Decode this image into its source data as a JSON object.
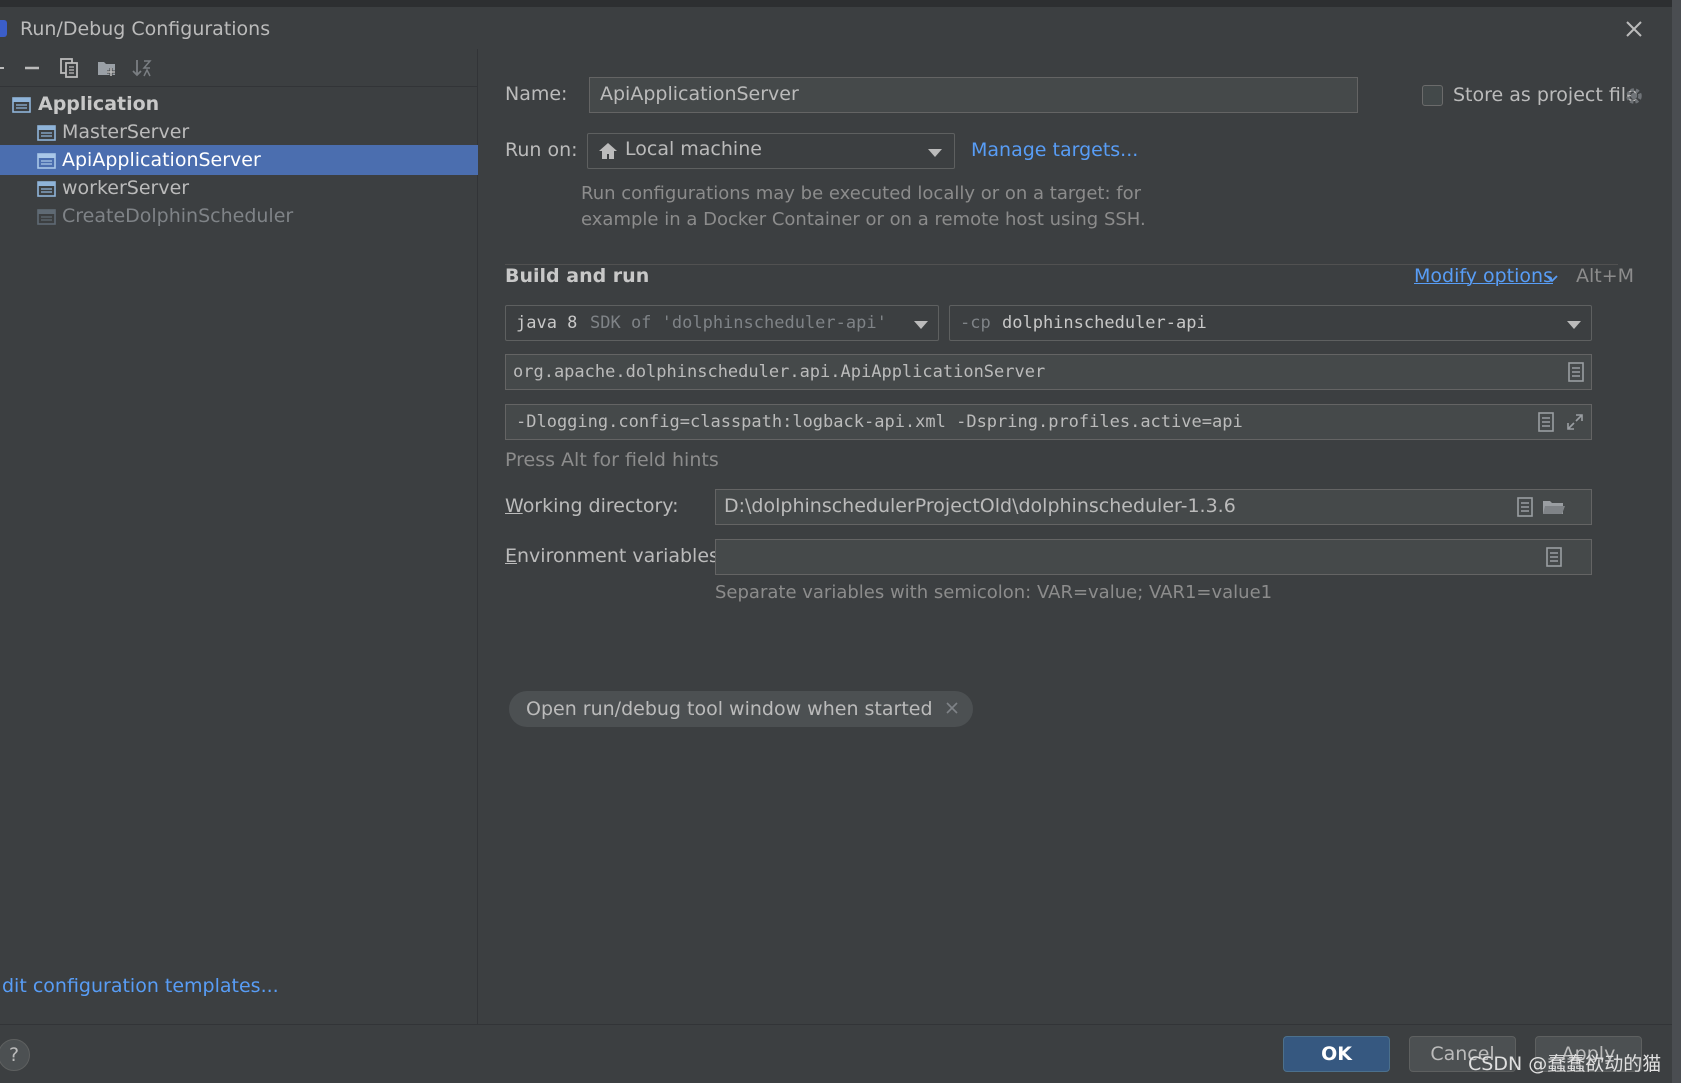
{
  "window": {
    "title": "Run/Debug Configurations"
  },
  "toolbar": {
    "icons": [
      "remove-icon",
      "copy-icon",
      "new-folder-icon",
      "sort-icon"
    ]
  },
  "tree": {
    "root_label": "Application",
    "items": [
      {
        "label": "MasterServer",
        "selected": false,
        "dimmed": false
      },
      {
        "label": "ApiApplicationServer",
        "selected": true,
        "dimmed": false
      },
      {
        "label": "workerServer",
        "selected": false,
        "dimmed": false
      },
      {
        "label": "CreateDolphinScheduler",
        "selected": false,
        "dimmed": true
      }
    ],
    "edit_templates_link": "dit configuration templates..."
  },
  "form": {
    "name_label": "Name:",
    "name_value": "ApiApplicationServer",
    "store_label": "Store as project file",
    "store_checked": false,
    "run_on_label": "Run on:",
    "run_on_value": "Local machine",
    "manage_targets_link": "Manage targets...",
    "run_on_hint_line1": "Run configurations may be executed locally or on a target: for",
    "run_on_hint_line2": "example in a Docker Container or on a remote host using SSH.",
    "build_run_heading": "Build and run",
    "modify_options_link": "Modify options",
    "modify_options_shortcut": "Alt+M",
    "jdk_main": "java 8",
    "jdk_secondary": "SDK of 'dolphinscheduler-api' r",
    "cp_prefix": "-cp",
    "cp_module": "dolphinscheduler-api",
    "main_class": "org.apache.dolphinscheduler.api.ApiApplicationServer",
    "vm_options": "-Dlogging.config=classpath:logback-api.xml -Dspring.profiles.active=api",
    "field_hints": "Press Alt for field hints",
    "working_dir_label": "Working directory:",
    "working_dir_value": "D:\\dolphinschedulerProjectOld\\dolphinscheduler-1.3.6",
    "env_vars_label": "Environment variables:",
    "env_vars_value": "",
    "env_vars_hint": "Separate variables with semicolon: VAR=value; VAR1=value1",
    "chip_label": "Open run/debug tool window when started"
  },
  "buttons": {
    "help": "?",
    "ok": "OK",
    "cancel": "Cancel",
    "apply": "Apply"
  },
  "watermark": "CSDN @蠢蠢欲动的猫",
  "colors": {
    "background": "#3c3f41",
    "selection": "#4b6eaf",
    "link": "#589df6",
    "ok_button": "#365880",
    "field": "#45494a"
  }
}
